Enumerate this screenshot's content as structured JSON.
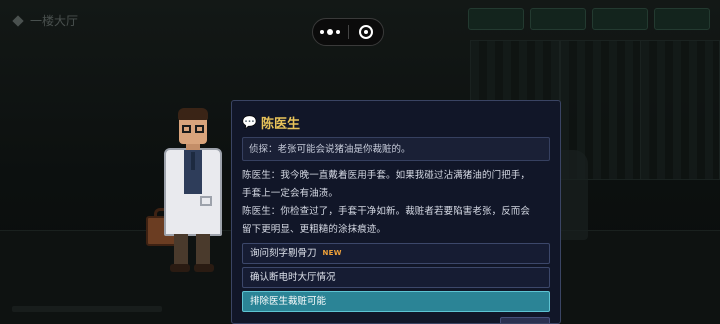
{
  "hud": {
    "location": "一楼大厅",
    "location_icon": "diamond-icon"
  },
  "dialogue": {
    "speaker": "陈医生",
    "speaker_icon": "speech-bubble-icon",
    "quote": "侦探：老张可能会说猪油是你裁赃的。",
    "lines": [
      "陈医生：我今晚一直戴着医用手套。如果我碰过沾满猪油的门把手，",
      "手套上一定会有油渍。",
      "陈医生：你检查过了，手套干净如新。裁赃者若要陷害老张，反而会",
      "留下更明显、更粗糙的涂抹痕迹。"
    ],
    "options": [
      {
        "label": "询问刻字剔骨刀",
        "badge": "NEW",
        "selected": false
      },
      {
        "label": "确认断电时大厅情况",
        "badge": "",
        "selected": false
      },
      {
        "label": "排除医生裁赃可能",
        "badge": "",
        "selected": true
      }
    ]
  },
  "colors": {
    "speaker_name": "#e8c35a",
    "panel_bg": "#111628",
    "selected_option": "#2b8496",
    "new_badge": "#f0a23a"
  }
}
